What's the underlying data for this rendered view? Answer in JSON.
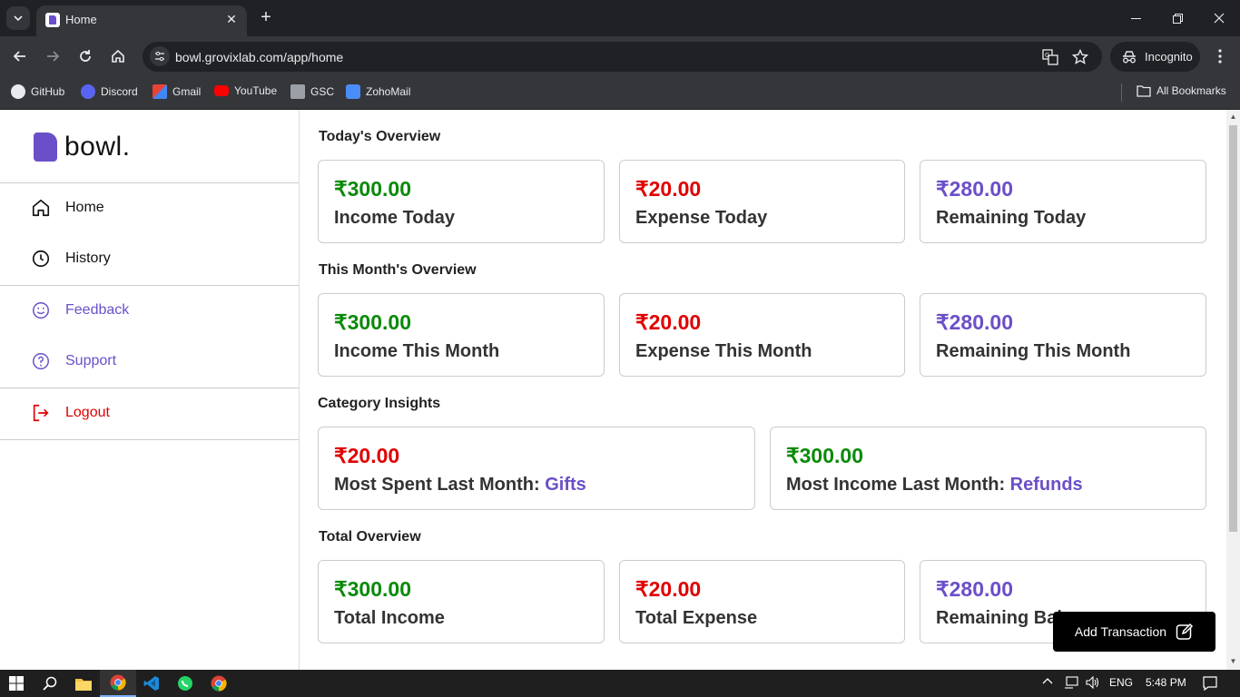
{
  "browser": {
    "tab_title": "Home",
    "url": "bowl.grovixlab.com/app/home",
    "incognito_label": "Incognito",
    "bookmarks": [
      {
        "label": "GitHub",
        "icon": "github-icon"
      },
      {
        "label": "Discord",
        "icon": "discord-icon"
      },
      {
        "label": "Gmail",
        "icon": "gmail-icon"
      },
      {
        "label": "YouTube",
        "icon": "youtube-icon"
      },
      {
        "label": "GSC",
        "icon": "gsc-icon"
      },
      {
        "label": "ZohoMail",
        "icon": "zohomail-icon"
      }
    ],
    "all_bookmarks_label": "All Bookmarks"
  },
  "app": {
    "logo_text": "bowl.",
    "nav": {
      "home": "Home",
      "history": "History",
      "feedback": "Feedback",
      "support": "Support",
      "logout": "Logout"
    },
    "colors": {
      "brand": "#6b4fc8",
      "income": "#0a8a0a",
      "expense": "#e00000",
      "logout": "#e00000"
    },
    "sections": {
      "today": {
        "title": "Today's Overview",
        "income": {
          "amount": "₹300.00",
          "label": "Income Today"
        },
        "expense": {
          "amount": "₹20.00",
          "label": "Expense Today"
        },
        "remaining": {
          "amount": "₹280.00",
          "label": "Remaining Today"
        }
      },
      "month": {
        "title": "This Month's Overview",
        "income": {
          "amount": "₹300.00",
          "label": "Income This Month"
        },
        "expense": {
          "amount": "₹20.00",
          "label": "Expense This Month"
        },
        "remaining": {
          "amount": "₹280.00",
          "label": "Remaining This Month"
        }
      },
      "category": {
        "title": "Category Insights",
        "spent": {
          "amount": "₹20.00",
          "label": "Most Spent Last Month:",
          "category": "Gifts"
        },
        "income": {
          "amount": "₹300.00",
          "label": "Most Income Last Month:",
          "category": "Refunds"
        }
      },
      "total": {
        "title": "Total Overview",
        "income": {
          "amount": "₹300.00",
          "label": "Total Income"
        },
        "expense": {
          "amount": "₹20.00",
          "label": "Total Expense"
        },
        "remaining": {
          "amount": "₹280.00",
          "label": "Remaining Balance"
        }
      }
    },
    "fab_label": "Add Transaction"
  },
  "taskbar": {
    "language": "ENG",
    "time": "5:48 PM"
  }
}
